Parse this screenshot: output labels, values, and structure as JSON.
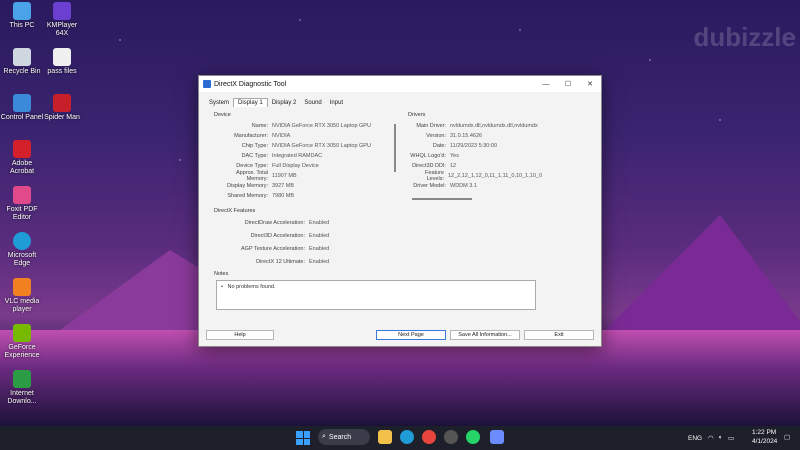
{
  "desktop": {
    "icons": [
      {
        "label": "This PC"
      },
      {
        "label": "KMPlayer 64X"
      },
      {
        "label": "Recycle Bin"
      },
      {
        "label": "pass files"
      },
      {
        "label": "Control Panel"
      },
      {
        "label": "Spider Man"
      },
      {
        "label": "Adobe Acrobat"
      },
      {
        "label": "Foxit PDF Editor"
      },
      {
        "label": "Microsoft Edge"
      },
      {
        "label": "VLC media player"
      },
      {
        "label": "GeForce Experience"
      },
      {
        "label": "Internet Downlo..."
      }
    ],
    "watermark": "dubizzle"
  },
  "window": {
    "title": "DirectX Diagnostic Tool",
    "controls": [
      "—",
      "☐",
      "✕"
    ],
    "tabs": [
      "System",
      "Display 1",
      "Display 2",
      "Sound",
      "Input"
    ],
    "active_tab": "Display 1",
    "device": {
      "heading": "Device",
      "rows": [
        {
          "k": "Name:",
          "v": "NVIDIA GeForce RTX 3050 Laptop GPU"
        },
        {
          "k": "Manufacturer:",
          "v": "NVIDIA"
        },
        {
          "k": "Chip Type:",
          "v": "NVIDIA GeForce RTX 3050 Laptop GPU"
        },
        {
          "k": "DAC Type:",
          "v": "Integrated RAMDAC"
        },
        {
          "k": "Device Type:",
          "v": "Full Display Device"
        },
        {
          "k": "Approx. Total Memory:",
          "v": "11907 MB"
        },
        {
          "k": "Display Memory:",
          "v": "3927 MB"
        },
        {
          "k": "Shared Memory:",
          "v": "7980 MB"
        }
      ]
    },
    "drivers": {
      "heading": "Drivers",
      "rows": [
        {
          "k": "Main Driver:",
          "v": "nvldumdx.dll,nvldumdx.dll,nvldumdx"
        },
        {
          "k": "Version:",
          "v": "31.0.15.4626"
        },
        {
          "k": "Date:",
          "v": "11/29/2023 5:30:00"
        },
        {
          "k": "WHQL Logo'd:",
          "v": "Yes"
        },
        {
          "k": "Direct3D DDI:",
          "v": "12"
        },
        {
          "k": "Feature Levels:",
          "v": "12_2,12_1,12_0,11_1,11_0,10_1,10_0"
        },
        {
          "k": "Driver Model:",
          "v": "WDDM 3.1"
        }
      ]
    },
    "features": {
      "heading": "DirectX Features",
      "rows": [
        {
          "k": "DirectDraw Acceleration:",
          "v": "Enabled"
        },
        {
          "k": "Direct3D Acceleration:",
          "v": "Enabled"
        },
        {
          "k": "AGP Texture Acceleration:",
          "v": "Enabled"
        },
        {
          "k": "DirectX 12 Ultimate:",
          "v": "Enabled"
        }
      ]
    },
    "notes": {
      "heading": "Notes",
      "items": [
        "No problems found."
      ]
    },
    "buttons": {
      "help": "Help",
      "next": "Next Page",
      "save": "Save All Information...",
      "exit": "Exit"
    }
  },
  "taskbar": {
    "search_label": "Search",
    "lang": "ENG",
    "time": "1:22 PM",
    "date": "4/1/2024"
  }
}
